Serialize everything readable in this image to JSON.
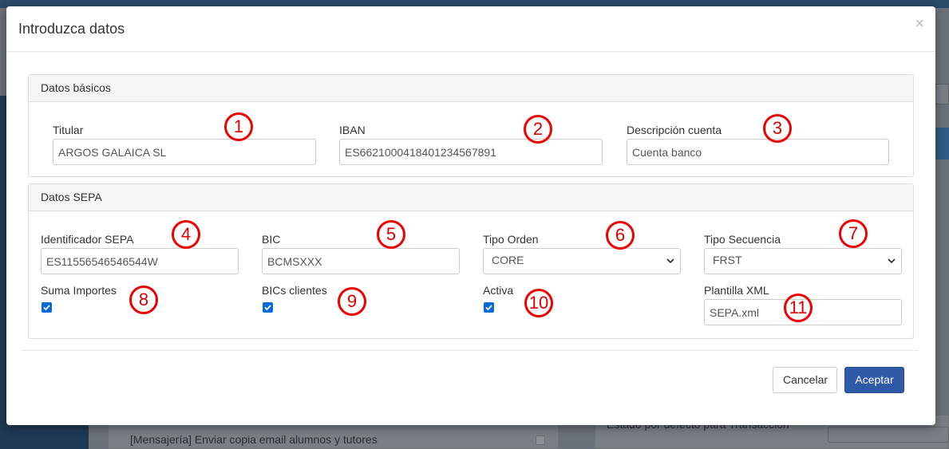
{
  "background": {
    "messaging_text": "[Mensajería] Enviar copia email alumnos y tutores",
    "estado_text": "Estado por defecto para Transacción"
  },
  "modal": {
    "title": "Introduzca datos",
    "close_symbol": "×"
  },
  "datos_basicos": {
    "heading": "Datos básicos",
    "titular": {
      "label": "Titular",
      "value": "ARGOS GALAICA SL"
    },
    "iban": {
      "label": "IBAN",
      "value": "ES6621000418401234567891"
    },
    "descripcion": {
      "label": "Descripción cuenta",
      "value": "Cuenta banco"
    }
  },
  "datos_sepa": {
    "heading": "Datos SEPA",
    "identificador": {
      "label": "Identificador SEPA",
      "value": "ES11556546546544W"
    },
    "bic": {
      "label": "BIC",
      "value": "BCMSXXX"
    },
    "tipo_orden": {
      "label": "Tipo Orden",
      "selected": "CORE"
    },
    "tipo_secuencia": {
      "label": "Tipo Secuencia",
      "selected": "FRST"
    },
    "suma_importes": {
      "label": "Suma Importes",
      "checked": true
    },
    "bics_clientes": {
      "label": "BICs clientes",
      "checked": true
    },
    "activa": {
      "label": "Activa",
      "checked": true
    },
    "plantilla": {
      "label": "Plantilla XML",
      "value": "SEPA.xml"
    }
  },
  "markers": [
    "1",
    "2",
    "3",
    "4",
    "5",
    "6",
    "7",
    "8",
    "9",
    "10",
    "11"
  ],
  "footer": {
    "cancel_label": "Cancelar",
    "accept_label": "Aceptar"
  },
  "colors": {
    "accent": "#2e5aa8",
    "marker": "#e00000",
    "checkbox": "#0b6bd6"
  }
}
